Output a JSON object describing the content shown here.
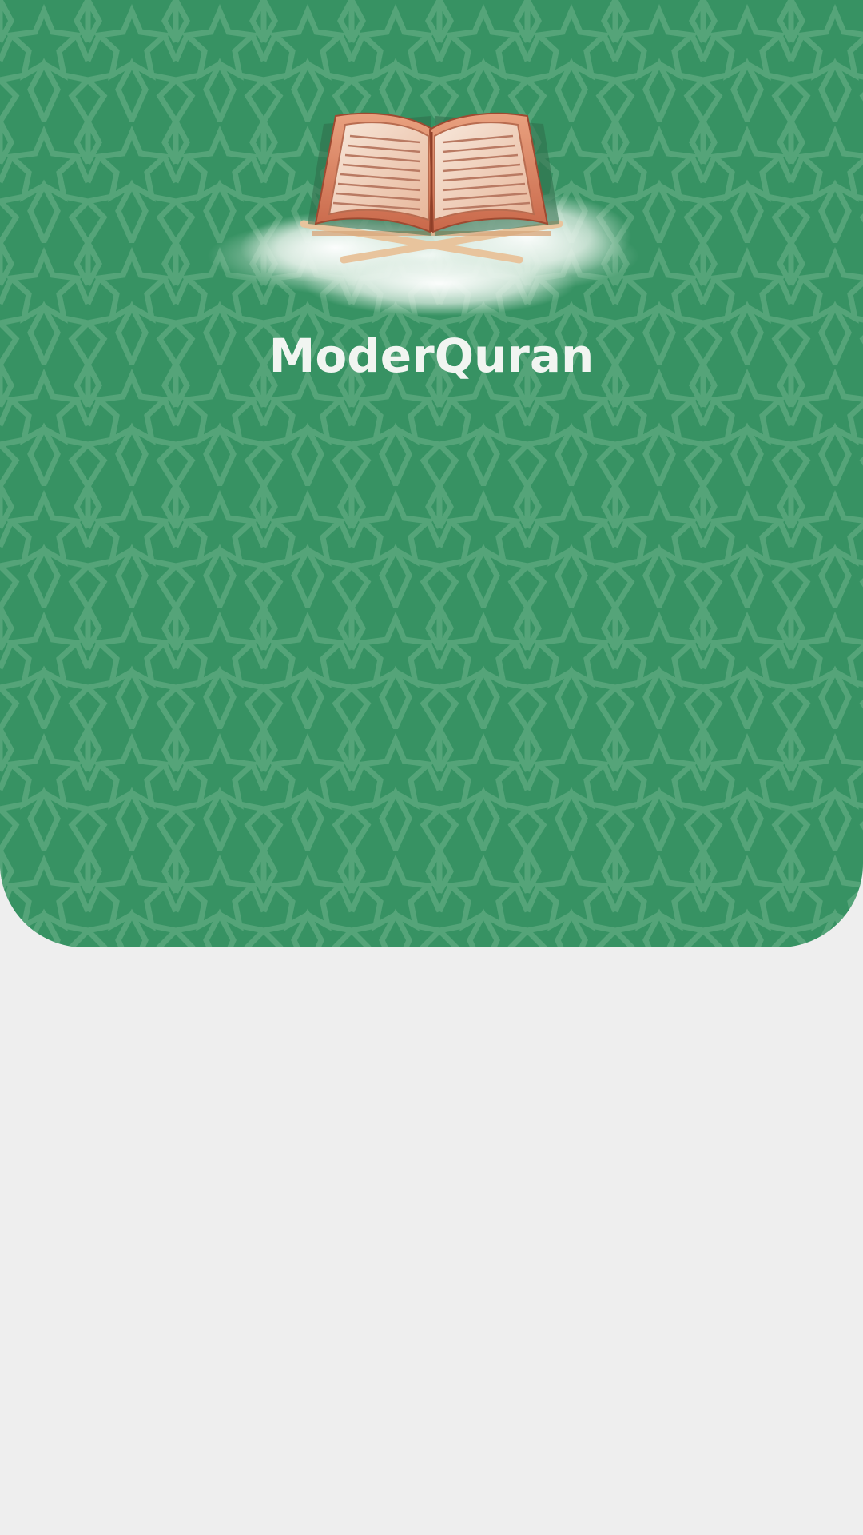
{
  "app": {
    "title": "ModerQuran"
  },
  "hero": {
    "illustration_icon": "quran-on-stand-icon",
    "background_color": "#379263",
    "pattern_color": "#5aa77c"
  },
  "page": {
    "background_color": "#eeeeee"
  }
}
